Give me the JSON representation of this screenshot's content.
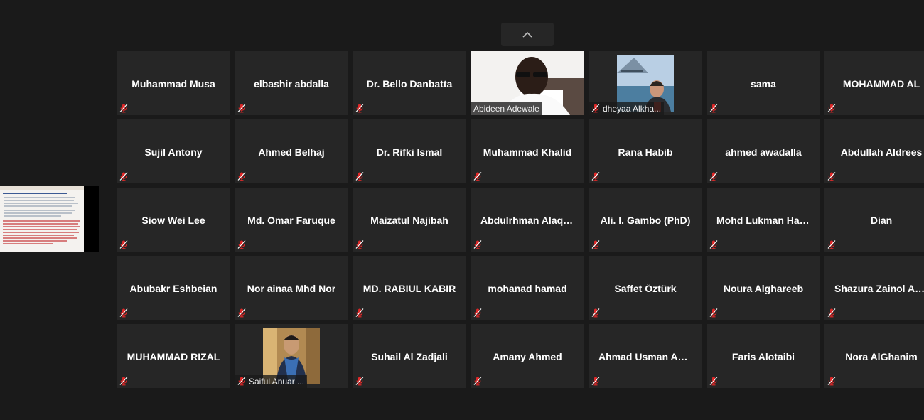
{
  "toolbar": {
    "collapse_icon": "chevron-up-icon"
  },
  "share": {
    "icon": "shared-document-thumbnail"
  },
  "colors": {
    "tile_bg": "#262626",
    "background": "#1a1a1a",
    "mute_red": "#e02828"
  },
  "participants": [
    {
      "name": "Muhammad Musa",
      "muted": true,
      "video": false
    },
    {
      "name": "elbashir abdalla",
      "muted": true,
      "video": false
    },
    {
      "name": "Dr. Bello  Danbatta",
      "muted": true,
      "video": false
    },
    {
      "name": "Abideen Adewale",
      "muted": false,
      "video": true
    },
    {
      "name": "dheyaa Alkhalidi",
      "muted": true,
      "video": true
    },
    {
      "name": "sama",
      "muted": true,
      "video": false
    },
    {
      "name": "MOHAMMAD  AL",
      "muted": true,
      "video": false
    },
    {
      "name": "Sujil Antony",
      "muted": true,
      "video": false
    },
    {
      "name": "Ahmed Belhaj",
      "muted": true,
      "video": false
    },
    {
      "name": "Dr. Rifki Ismal",
      "muted": true,
      "video": false
    },
    {
      "name": "Muhammad  Khalid",
      "muted": true,
      "video": false
    },
    {
      "name": "Rana Habib",
      "muted": true,
      "video": false
    },
    {
      "name": "ahmed awadalla",
      "muted": true,
      "video": false
    },
    {
      "name": "Abdullah Aldrees",
      "muted": true,
      "video": false
    },
    {
      "name": "Siow Wei Lee",
      "muted": true,
      "video": false
    },
    {
      "name": "Md. Omar  Faruque",
      "muted": true,
      "video": false
    },
    {
      "name": "Maizatul  Najibah",
      "muted": true,
      "video": false
    },
    {
      "name": "Abdulrhman  Alaqeel",
      "muted": true,
      "video": false
    },
    {
      "name": "Ali. I. Gambo  (PhD)",
      "muted": true,
      "video": false
    },
    {
      "name": "Mohd  Lukman Hakim",
      "muted": true,
      "video": false
    },
    {
      "name": "Dian",
      "muted": true,
      "video": false
    },
    {
      "name": "Abubakr Eshbeian",
      "muted": true,
      "video": false
    },
    {
      "name": "Nor ainaa  Mhd Nor",
      "muted": true,
      "video": false
    },
    {
      "name": "MD. RABIUL KABIR",
      "muted": true,
      "video": false
    },
    {
      "name": "mohanad hamad",
      "muted": true,
      "video": false
    },
    {
      "name": "Saffet Öztürk",
      "muted": true,
      "video": false
    },
    {
      "name": "Noura Alghareeb",
      "muted": true,
      "video": false
    },
    {
      "name": "Shazura  Zainol Abidin",
      "muted": true,
      "video": false
    },
    {
      "name": "MUHAMMAD  RIZAL",
      "muted": true,
      "video": false
    },
    {
      "name": "Saiful Anuar Saad",
      "muted": true,
      "video": true
    },
    {
      "name": "Suhail Al Zadjali",
      "muted": true,
      "video": false
    },
    {
      "name": "Amany Ahmed",
      "muted": true,
      "video": false
    },
    {
      "name": "Ahmad  Usman Ahmad",
      "muted": true,
      "video": false
    },
    {
      "name": "Faris Alotaibi",
      "muted": true,
      "video": false
    },
    {
      "name": "Nora AlGhanim",
      "muted": true,
      "video": false
    }
  ],
  "video_labels": {
    "abideen": "Abideen Adewale",
    "dheyaa": "dheyaa Alkha...",
    "saiful": "Saiful Anuar ..."
  }
}
